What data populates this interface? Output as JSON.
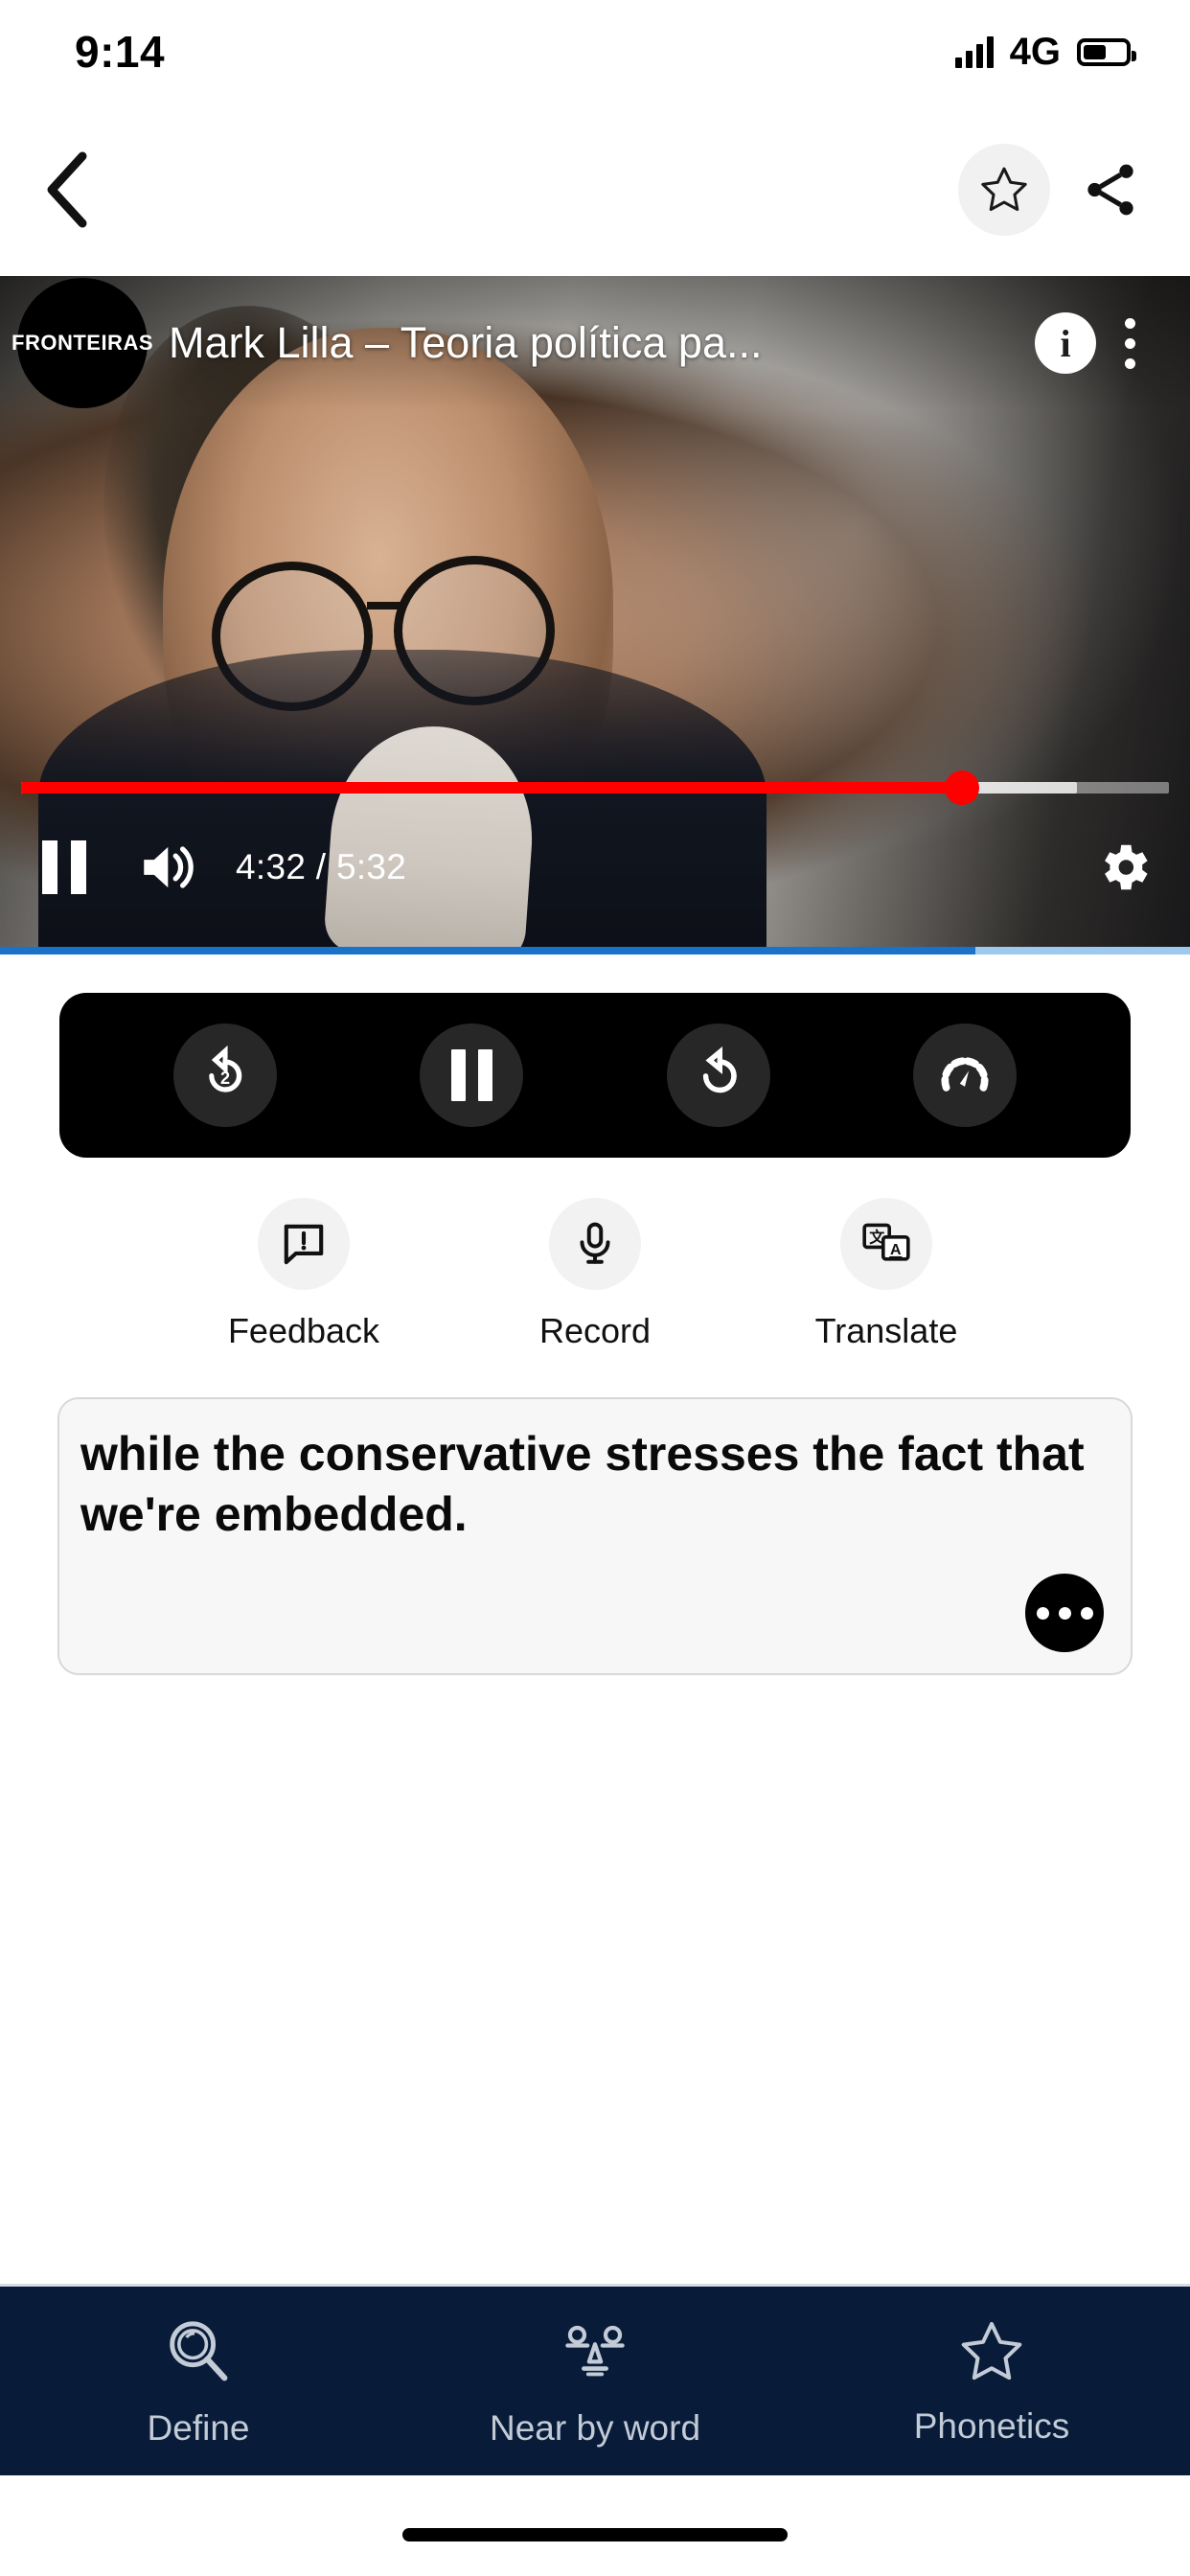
{
  "status_bar": {
    "time": "9:14",
    "network": "4G",
    "signal_icon": "signal-bars-icon",
    "battery_icon": "battery-icon",
    "battery_level_pct": 55
  },
  "top_nav": {
    "back_icon": "back-chevron-icon",
    "favorite_icon": "star-outline-icon",
    "share_icon": "share-icon"
  },
  "player": {
    "channel_logo_text": "FRONTEIRAS",
    "title": "Mark Lilla – Teoria política pa...",
    "info_icon": "info-icon",
    "info_label": "i",
    "more_icon": "kebab-menu-icon",
    "pause_icon": "pause-icon",
    "volume_icon": "volume-on-icon",
    "settings_icon": "gear-icon",
    "current_time": "4:32",
    "duration": "5:32",
    "time_display": "4:32 / 5:32",
    "progress_pct": 82,
    "buffered_pct": 92,
    "progress_color": "#ff0000"
  },
  "load_bar": {
    "progress_pct": 82,
    "fill_color": "#1a73c8",
    "track_color": "#9dc9ef"
  },
  "playback_controls": {
    "background_color": "#000000",
    "buttons": [
      {
        "name": "rewind-2-seconds-button",
        "icon": "replay-2-icon",
        "badge": "2"
      },
      {
        "name": "pause-button",
        "icon": "pause-icon"
      },
      {
        "name": "repeat-button",
        "icon": "loop-icon"
      },
      {
        "name": "playback-speed-button",
        "icon": "speedometer-icon"
      }
    ]
  },
  "actions": [
    {
      "name": "feedback-button",
      "icon": "feedback-bubble-icon",
      "label": "Feedback"
    },
    {
      "name": "record-button",
      "icon": "microphone-icon",
      "label": "Record"
    },
    {
      "name": "translate-button",
      "icon": "translate-icon",
      "label": "Translate"
    }
  ],
  "subtitle_card": {
    "text": "while the conservative stresses the fact that we're embedded.",
    "more_icon": "more-dots-icon",
    "background_color": "#f7f7f7"
  },
  "bottom_nav": {
    "background_color": "#081c3a",
    "items": [
      {
        "name": "bottom-nav-define",
        "icon": "magnifier-icon",
        "label": "Define"
      },
      {
        "name": "bottom-nav-nearby-word",
        "icon": "balance-scale-icon",
        "label": "Near by word"
      },
      {
        "name": "bottom-nav-phonetics",
        "icon": "star-outline-icon",
        "label": "Phonetics"
      }
    ]
  },
  "home_indicator": "home-indicator"
}
